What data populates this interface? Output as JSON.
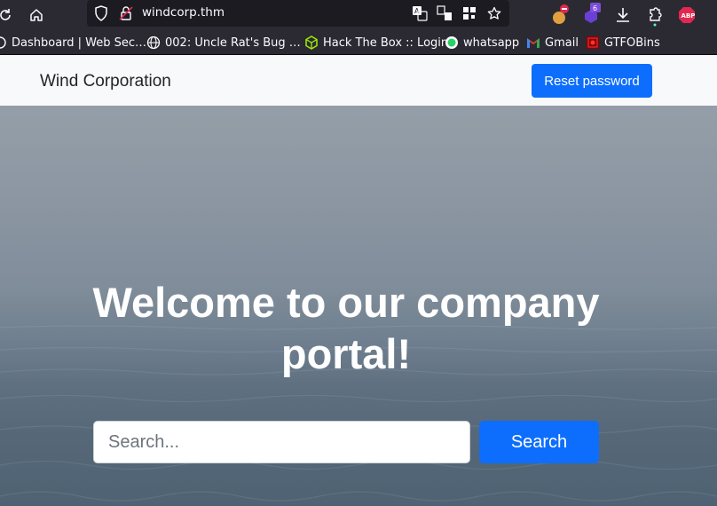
{
  "browser": {
    "url": "windcorp.thm",
    "extension_badge": "6",
    "abp_label": "ABP"
  },
  "bookmarks": [
    {
      "label": "Dashboard | Web Sec…",
      "icon": "partial-icon"
    },
    {
      "label": "002: Uncle Rat's Bug …",
      "icon": "globe-icon"
    },
    {
      "label": "Hack The Box :: Login",
      "icon": "htb-cube-icon"
    },
    {
      "label": "whatsapp",
      "icon": "whatsapp-icon"
    },
    {
      "label": "Gmail",
      "icon": "gmail-icon"
    },
    {
      "label": "GTFOBins",
      "icon": "gtfobins-icon"
    }
  ],
  "navbar": {
    "brand": "Wind Corporation",
    "reset_password_label": "Reset password"
  },
  "hero": {
    "title": "Welcome to our company portal!",
    "search_placeholder": "Search...",
    "search_button_label": "Search"
  },
  "colors": {
    "primary": "#0d6efd",
    "navbar_bg": "#f8f9fa",
    "browser_chrome": "#2b2a33"
  }
}
